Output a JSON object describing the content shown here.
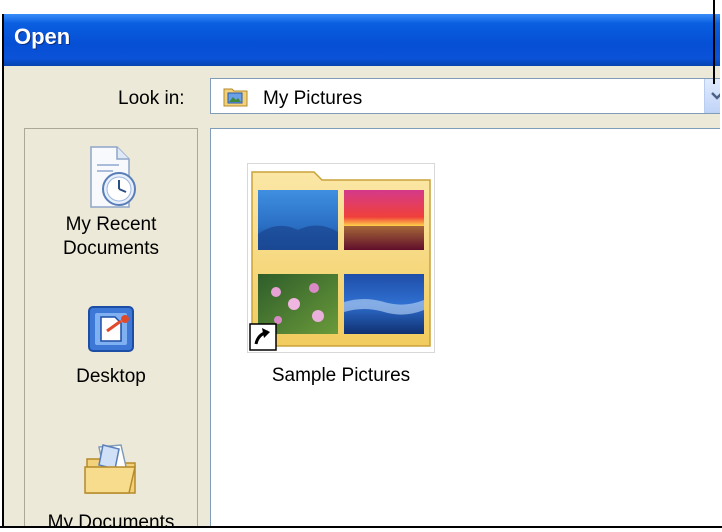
{
  "window": {
    "title": "Open"
  },
  "look_in": {
    "label": "Look in:",
    "value": "My Pictures",
    "icon": "my-pictures-folder-icon"
  },
  "places_bar": {
    "items": [
      {
        "label_line1": "My Recent",
        "label_line2": "Documents",
        "icon": "recent-documents-icon"
      },
      {
        "label": "Desktop",
        "icon": "desktop-icon"
      },
      {
        "label": "My Documents",
        "icon": "my-documents-icon"
      }
    ]
  },
  "files": [
    {
      "name": "Sample Pictures",
      "type": "folder-shortcut",
      "icon": "folder-thumbnail-icon"
    }
  ],
  "colors": {
    "title_bar": "#0a55db",
    "dialog_bg": "#ece9d8",
    "pane_border": "#7f9db9"
  }
}
